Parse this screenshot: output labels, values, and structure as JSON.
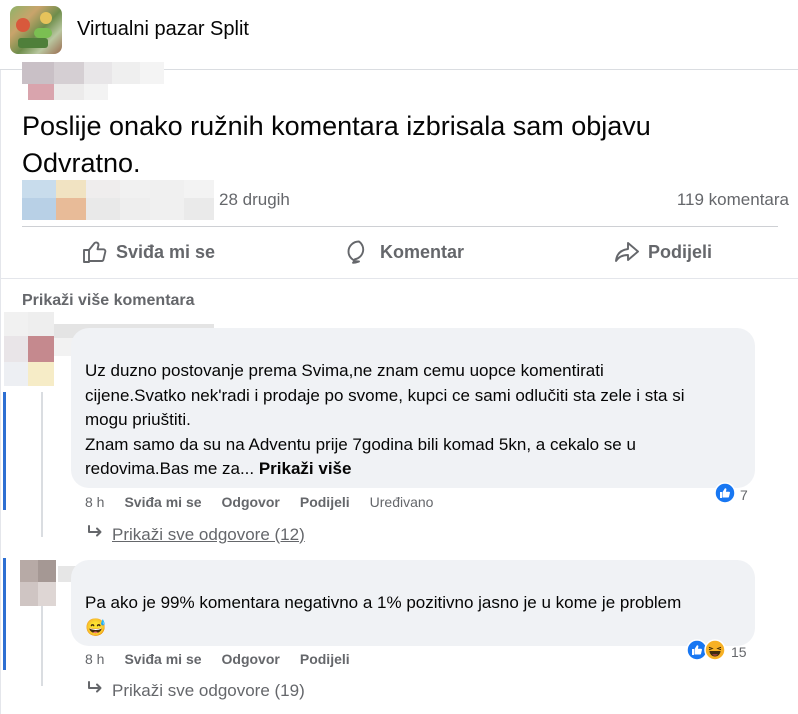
{
  "group": {
    "name": "Virtualni pazar Split"
  },
  "post": {
    "text_lines": [
      "Poslije onako ružnih komentara izbrisala sam objavu",
      "Odvratno."
    ],
    "reactions_others": "28 drugih",
    "comment_count": "119 komentara"
  },
  "actions": {
    "like": "Sviđa mi se",
    "comment": "Komentar",
    "share": "Podijeli"
  },
  "show_more_comments": "Prikaži više komentara",
  "comments": [
    {
      "lines": [
        "Uz duzno postovanje prema Svima,ne znam cemu uopce komentirati",
        "cijene.Svatko nek'radi i prodaje po svome, kupci ce sami odlučiti sta zele i sta si",
        "mogu priuštiti.",
        "Znam samo da su na Adventu prije 7godina bili komad 5kn, a cekalo se u",
        "redovima.Bas me za... "
      ],
      "see_more": "Prikaži više",
      "time": "8 h",
      "like": "Sviđa mi se",
      "reply": "Odgovor",
      "share": "Podijeli",
      "edited": "Uređivano",
      "reaction_count": "7",
      "replies_link": "Prikaži sve odgovore (12)"
    },
    {
      "lines": [
        "Pa ako je 99% komentara negativno a 1% pozitivno jasno je u kome je problem"
      ],
      "emoji": "😅",
      "time": "8 h",
      "like": "Sviđa mi se",
      "reply": "Odgovor",
      "share": "Podijeli",
      "reaction_count": "15",
      "replies_link": "Prikaži sve odgovore (19)"
    }
  ],
  "icons": {
    "like": "thumbs-up-icon",
    "comment": "speech-bubble-icon",
    "share": "share-arrow-icon",
    "reply": "reply-arrow-icon",
    "reaction_like": "like-reaction-icon",
    "reaction_haha": "haha-reaction-icon"
  },
  "colors": {
    "accent": "#1877f2",
    "muted": "#65676b",
    "bubble": "#f0f2f5",
    "thread": "#2d6fd2"
  }
}
